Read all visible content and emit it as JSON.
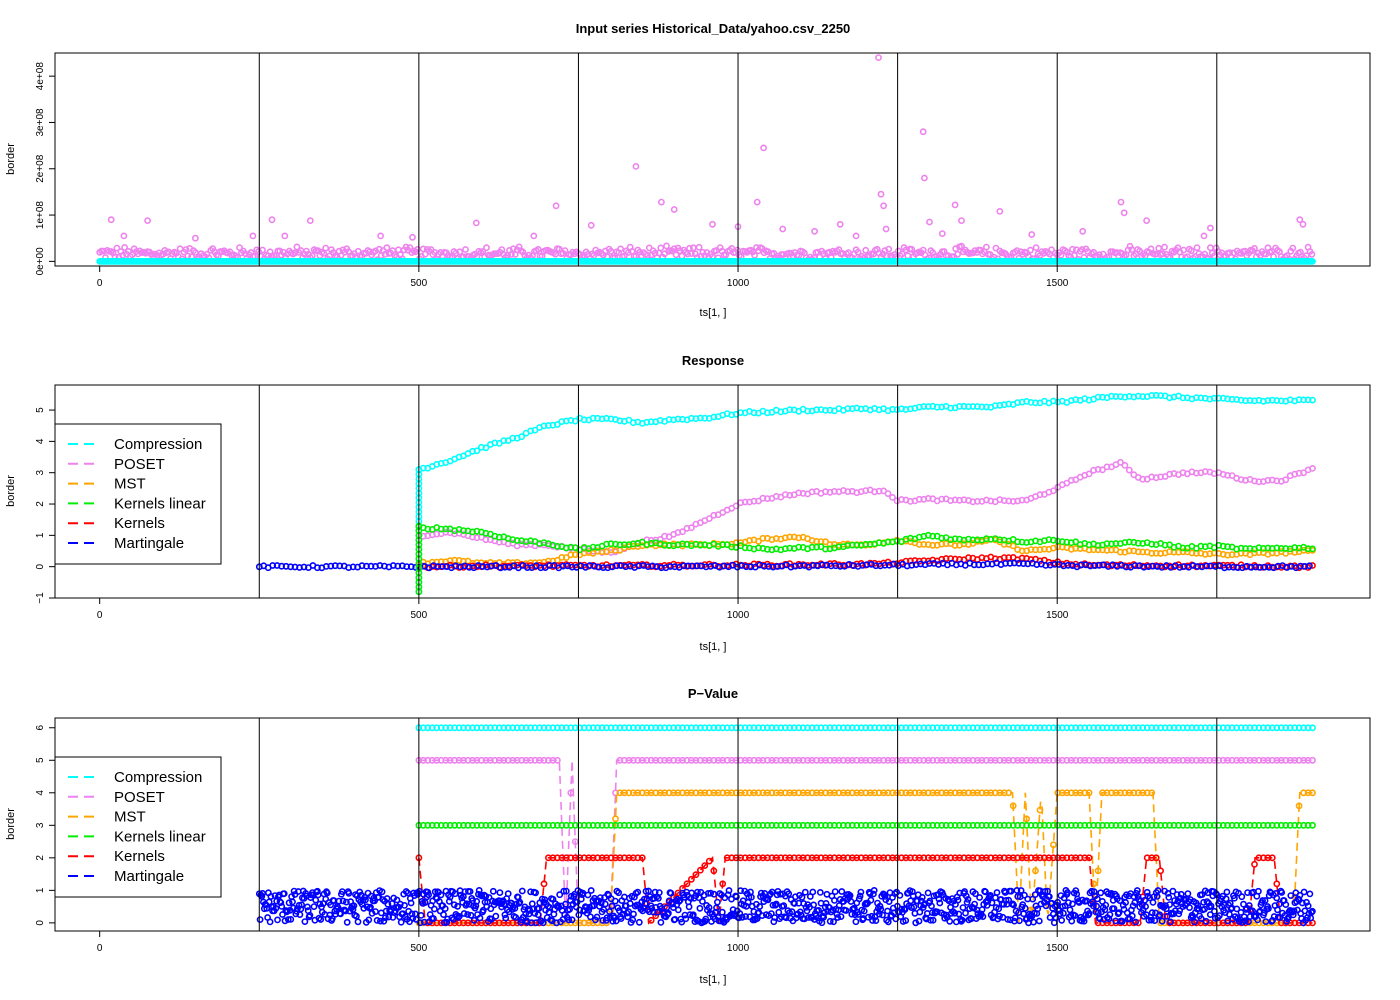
{
  "chart_data": [
    {
      "type": "scatter",
      "title": "Input series Historical_Data/yahoo.csv_2250",
      "xlabel": "ts[1, ]",
      "ylabel": "border",
      "xlim": [
        -70,
        1990
      ],
      "ylim": [
        -10000000,
        450000000
      ],
      "x_ticks": [
        0,
        500,
        1000,
        1500
      ],
      "x_tick_labels": [
        "0",
        "500",
        "1000",
        "1500"
      ],
      "y_ticks": [
        0,
        100000000,
        200000000,
        300000000,
        400000000
      ],
      "y_tick_labels": [
        "0e+00",
        "1e+08",
        "2e+08",
        "3e+08",
        "4e+08"
      ],
      "vlines": [
        250,
        500,
        750,
        1000,
        1250,
        1500,
        1750
      ],
      "x_range": [
        0,
        1900
      ],
      "series": [
        {
          "color": "#ee82ee",
          "baseline": 15000000,
          "noise": 10000000,
          "spikes": [
            [
              18,
              90000000
            ],
            [
              38,
              55000000
            ],
            [
              75,
              88000000
            ],
            [
              150,
              50000000
            ],
            [
              240,
              55000000
            ],
            [
              270,
              90000000
            ],
            [
              290,
              55000000
            ],
            [
              330,
              88000000
            ],
            [
              440,
              55000000
            ],
            [
              490,
              52000000
            ],
            [
              590,
              83000000
            ],
            [
              680,
              55000000
            ],
            [
              715,
              120000000
            ],
            [
              770,
              78000000
            ],
            [
              840,
              205000000
            ],
            [
              880,
              128000000
            ],
            [
              900,
              112000000
            ],
            [
              960,
              80000000
            ],
            [
              1000,
              75000000
            ],
            [
              1030,
              128000000
            ],
            [
              1040,
              245000000
            ],
            [
              1070,
              70000000
            ],
            [
              1120,
              65000000
            ],
            [
              1160,
              80000000
            ],
            [
              1185,
              55000000
            ],
            [
              1220,
              440000000
            ],
            [
              1224,
              145000000
            ],
            [
              1228,
              120000000
            ],
            [
              1232,
              70000000
            ],
            [
              1290,
              280000000
            ],
            [
              1292,
              180000000
            ],
            [
              1300,
              85000000
            ],
            [
              1320,
              60000000
            ],
            [
              1340,
              122000000
            ],
            [
              1350,
              88000000
            ],
            [
              1410,
              108000000
            ],
            [
              1460,
              58000000
            ],
            [
              1540,
              65000000
            ],
            [
              1600,
              128000000
            ],
            [
              1605,
              105000000
            ],
            [
              1640,
              88000000
            ],
            [
              1730,
              55000000
            ],
            [
              1740,
              72000000
            ],
            [
              1880,
              90000000
            ],
            [
              1885,
              80000000
            ]
          ]
        },
        {
          "color": "#00ffff",
          "baseline": 0,
          "noise": 0,
          "spikes": []
        }
      ]
    },
    {
      "type": "scatter",
      "title": "Response",
      "xlabel": "ts[1, ]",
      "ylabel": "border",
      "xlim": [
        -70,
        1990
      ],
      "ylim": [
        -1,
        5.8
      ],
      "x_ticks": [
        0,
        500,
        1000,
        1500
      ],
      "x_tick_labels": [
        "0",
        "500",
        "1000",
        "1500"
      ],
      "y_ticks": [
        -1,
        0,
        1,
        2,
        3,
        4,
        5
      ],
      "y_tick_labels": [
        "−1",
        "0",
        "1",
        "2",
        "3",
        "4",
        "5"
      ],
      "vlines": [
        250,
        500,
        750,
        1000,
        1250,
        1500,
        1750
      ],
      "legend": {
        "position": "left",
        "entries": [
          {
            "label": "Compression",
            "color": "#00ffff"
          },
          {
            "label": "POSET",
            "color": "#ee82ee"
          },
          {
            "label": "MST",
            "color": "#ffa500"
          },
          {
            "label": "Kernels linear",
            "color": "#00ee00"
          },
          {
            "label": "Kernels",
            "color": "#ff0000"
          },
          {
            "label": "Martingale",
            "color": "#0000ff"
          }
        ]
      },
      "series": [
        {
          "name": "Compression",
          "color": "#00ffff",
          "x": [
            500,
            550,
            600,
            650,
            700,
            750,
            800,
            850,
            900,
            950,
            1000,
            1050,
            1100,
            1150,
            1200,
            1250,
            1300,
            1350,
            1400,
            1450,
            1500,
            1550,
            1600,
            1650,
            1700,
            1750,
            1800,
            1850,
            1900
          ],
          "y": [
            3.1,
            3.4,
            3.8,
            4.1,
            4.5,
            4.7,
            4.7,
            4.6,
            4.7,
            4.75,
            4.9,
            4.95,
            5.0,
            5.0,
            5.05,
            5.0,
            5.1,
            5.1,
            5.1,
            5.25,
            5.25,
            5.35,
            5.45,
            5.45,
            5.4,
            5.35,
            5.3,
            5.3,
            5.3
          ]
        },
        {
          "name": "POSET",
          "color": "#ee82ee",
          "x": [
            500,
            550,
            600,
            650,
            700,
            750,
            800,
            850,
            900,
            950,
            1000,
            1050,
            1100,
            1150,
            1200,
            1230,
            1250,
            1300,
            1350,
            1400,
            1450,
            1500,
            1550,
            1600,
            1630,
            1650,
            1700,
            1750,
            1800,
            1850,
            1900
          ],
          "y": [
            1.0,
            1.1,
            0.9,
            0.7,
            0.7,
            0.55,
            0.45,
            0.8,
            1.0,
            1.5,
            2.0,
            2.2,
            2.35,
            2.4,
            2.4,
            2.45,
            2.1,
            2.15,
            2.1,
            2.1,
            2.1,
            2.5,
            3.0,
            3.3,
            2.8,
            2.85,
            3.0,
            3.0,
            2.75,
            2.75,
            3.15
          ]
        },
        {
          "name": "MST",
          "color": "#ffa500",
          "x": [
            500,
            550,
            600,
            650,
            700,
            750,
            800,
            850,
            900,
            950,
            1000,
            1050,
            1100,
            1150,
            1200,
            1250,
            1300,
            1350,
            1400,
            1450,
            1500,
            1550,
            1600,
            1650,
            1700,
            1750,
            1800,
            1850,
            1900
          ],
          "y": [
            0.1,
            0.2,
            0.1,
            0.1,
            0.15,
            0.4,
            0.5,
            0.7,
            0.7,
            0.7,
            0.75,
            0.9,
            0.95,
            0.7,
            0.7,
            0.85,
            0.7,
            0.7,
            0.85,
            0.5,
            0.6,
            0.55,
            0.5,
            0.45,
            0.45,
            0.4,
            0.4,
            0.45,
            0.5
          ]
        },
        {
          "name": "Kernels linear",
          "color": "#00ee00",
          "x": [
            500,
            550,
            600,
            650,
            700,
            750,
            800,
            850,
            900,
            950,
            1000,
            1050,
            1100,
            1150,
            1200,
            1250,
            1300,
            1350,
            1400,
            1450,
            1500,
            1550,
            1600,
            1650,
            1700,
            1750,
            1800,
            1850,
            1900
          ],
          "y": [
            1.25,
            1.2,
            1.1,
            0.85,
            0.75,
            0.55,
            0.7,
            0.75,
            0.7,
            0.7,
            0.65,
            0.55,
            0.6,
            0.6,
            0.7,
            0.8,
            1.0,
            0.85,
            0.9,
            0.8,
            0.85,
            0.7,
            0.75,
            0.75,
            0.6,
            0.65,
            0.55,
            0.6,
            0.6
          ]
        },
        {
          "name": "Kernels",
          "color": "#ff0000",
          "x": [
            500,
            600,
            700,
            800,
            900,
            1000,
            1100,
            1200,
            1250,
            1300,
            1350,
            1400,
            1450,
            1500,
            1550,
            1600,
            1700,
            1800,
            1900
          ],
          "y": [
            0.0,
            0.02,
            0.03,
            0.03,
            0.04,
            0.05,
            0.06,
            0.08,
            0.12,
            0.2,
            0.25,
            0.28,
            0.25,
            0.12,
            0.05,
            0.04,
            0.03,
            0.02,
            0.0
          ]
        },
        {
          "name": "Martingale",
          "color": "#0000ff",
          "x": [
            250,
            500,
            700,
            900,
            1100,
            1250,
            1350,
            1450,
            1500,
            1600,
            1700,
            1900
          ],
          "y": [
            0.0,
            0.0,
            0.0,
            0.0,
            0.02,
            0.05,
            0.08,
            0.08,
            0.04,
            0.02,
            0.0,
            0.0
          ]
        }
      ]
    },
    {
      "type": "scatter",
      "title": "P−Value",
      "xlabel": "ts[1, ]",
      "ylabel": "border",
      "xlim": [
        -70,
        1990
      ],
      "ylim": [
        -0.25,
        6.3
      ],
      "x_ticks": [
        0,
        500,
        1000,
        1500
      ],
      "x_tick_labels": [
        "0",
        "500",
        "1000",
        "1500"
      ],
      "y_ticks": [
        0,
        1,
        2,
        3,
        4,
        5,
        6
      ],
      "y_tick_labels": [
        "0",
        "1",
        "2",
        "3",
        "4",
        "5",
        "6"
      ],
      "vlines": [
        250,
        500,
        750,
        1000,
        1250,
        1500,
        1750
      ],
      "legend": {
        "position": "left",
        "entries": [
          {
            "label": "Compression",
            "color": "#00ffff"
          },
          {
            "label": "POSET",
            "color": "#ee82ee"
          },
          {
            "label": "MST",
            "color": "#ffa500"
          },
          {
            "label": "Kernels linear",
            "color": "#00ee00"
          },
          {
            "label": "Kernels",
            "color": "#ff0000"
          },
          {
            "label": "Martingale",
            "color": "#0000ff"
          }
        ]
      },
      "series": [
        {
          "name": "Compression",
          "color": "#00ffff",
          "x": [
            500,
            1900
          ],
          "y": [
            6,
            6
          ]
        },
        {
          "name": "POSET",
          "color": "#ee82ee",
          "x": [
            500,
            720,
            730,
            740,
            750,
            800,
            810,
            1900
          ],
          "y": [
            5,
            5,
            0,
            5,
            0,
            0,
            5,
            5
          ]
        },
        {
          "name": "MST",
          "color": "#ffa500",
          "x": [
            500,
            800,
            810,
            1430,
            1440,
            1450,
            1460,
            1475,
            1485,
            1500,
            1550,
            1560,
            1570,
            1650,
            1660,
            1870,
            1880,
            1900
          ],
          "y": [
            0,
            0,
            4,
            4,
            0,
            4,
            0,
            4,
            0,
            4,
            4,
            0,
            4,
            4,
            0,
            0,
            4,
            4
          ]
        },
        {
          "name": "Kernels linear",
          "color": "#00ee00",
          "x": [
            500,
            1900
          ],
          "y": [
            3,
            3
          ]
        },
        {
          "name": "Kernels",
          "color": "#ff0000",
          "x": [
            500,
            510,
            690,
            700,
            850,
            860,
            960,
            970,
            980,
            1550,
            1560,
            1630,
            1640,
            1660,
            1670,
            1800,
            1810,
            1840,
            1850,
            1900
          ],
          "y": [
            2,
            0,
            0,
            2,
            2,
            0,
            2,
            0,
            2,
            2,
            0,
            0,
            2,
            2,
            0,
            0,
            2,
            2,
            0,
            0
          ]
        },
        {
          "name": "Martingale",
          "color": "#0000ff",
          "x_range": [
            250,
            1900
          ],
          "random_range": [
            0,
            1
          ]
        }
      ]
    }
  ]
}
